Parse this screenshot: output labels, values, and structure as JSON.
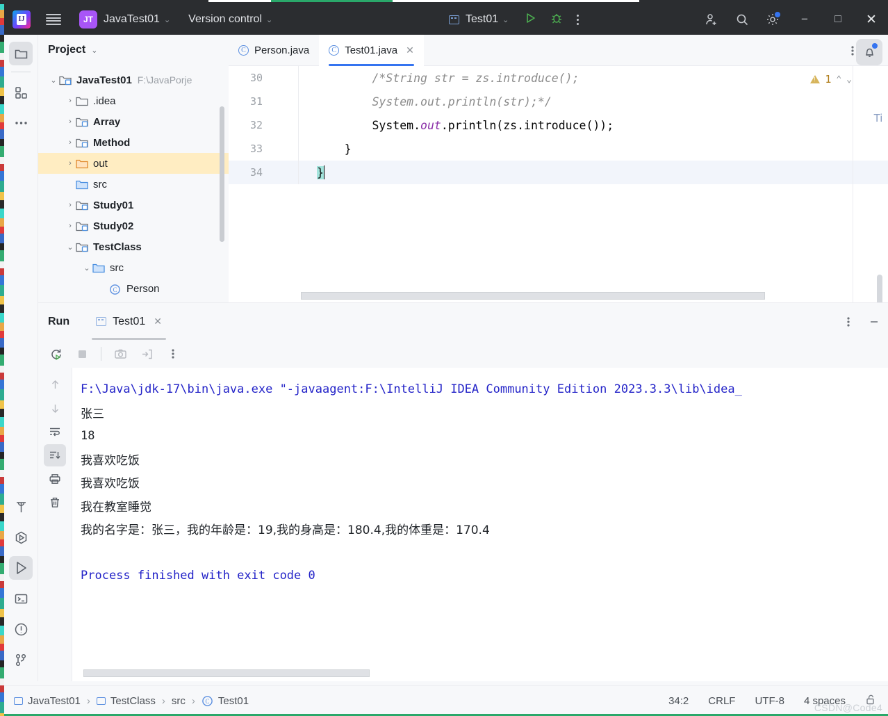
{
  "titlebar": {
    "logo_alt": "intellij-idea-logo",
    "menu_icon": "hamburger-menu-icon",
    "project_badge": "JT",
    "project_name": "JavaTest01",
    "project_chevron": "⌄",
    "vcs_label": "Version control",
    "vcs_chevron": "⌄",
    "run_config_name": "Test01",
    "run_config_chevron": "⌄",
    "run_icon": "run-icon",
    "debug_icon": "debug-icon",
    "more_icon": "more-vertical-icon",
    "add_user_icon": "add-user-icon",
    "search_icon": "search-icon",
    "settings_icon": "settings-gear-icon",
    "minimize": "−",
    "maximize": "□",
    "close": "✕"
  },
  "left_strip": {
    "items": [
      {
        "name": "project-tool-window",
        "icon": "folder-icon",
        "active": true
      },
      {
        "name": "structure-tool-window",
        "icon": "structure-icon",
        "active": false
      },
      {
        "name": "more-tool-windows",
        "icon": "more-horizontal-icon",
        "active": false
      }
    ],
    "bottom_items": [
      {
        "name": "build-tool-window",
        "icon": "hammer-icon",
        "active": false
      },
      {
        "name": "services-tool-window",
        "icon": "run-hex-icon",
        "active": false
      },
      {
        "name": "run-tool-window",
        "icon": "run-triangle-icon",
        "active": true
      },
      {
        "name": "terminal-tool-window",
        "icon": "terminal-icon",
        "active": false
      },
      {
        "name": "problems-tool-window",
        "icon": "exclamation-circle-icon",
        "active": false
      },
      {
        "name": "git-tool-window",
        "icon": "git-branch-icon",
        "active": false
      }
    ]
  },
  "project_panel": {
    "title": "Project",
    "chevron": "⌄",
    "tree": [
      {
        "label": "JavaTest01",
        "path": "F:\\JavaPorje",
        "indent": 0,
        "arrow": "⌄",
        "icon": "module-icon",
        "bold": true,
        "selected": false
      },
      {
        "label": ".idea",
        "path": "",
        "indent": 1,
        "arrow": "›",
        "icon": "folder-icon",
        "bold": false,
        "selected": false
      },
      {
        "label": "Array",
        "path": "",
        "indent": 1,
        "arrow": "›",
        "icon": "module-icon",
        "bold": true,
        "selected": false
      },
      {
        "label": "Method",
        "path": "",
        "indent": 1,
        "arrow": "›",
        "icon": "module-icon",
        "bold": true,
        "selected": false
      },
      {
        "label": "out",
        "path": "",
        "indent": 1,
        "arrow": "›",
        "icon": "folder-orange-icon",
        "bold": false,
        "selected": true
      },
      {
        "label": "src",
        "path": "",
        "indent": 1,
        "arrow": "",
        "icon": "folder-blue-icon",
        "bold": false,
        "selected": false
      },
      {
        "label": "Study01",
        "path": "",
        "indent": 1,
        "arrow": "›",
        "icon": "module-icon",
        "bold": true,
        "selected": false
      },
      {
        "label": "Study02",
        "path": "",
        "indent": 1,
        "arrow": "›",
        "icon": "module-icon",
        "bold": true,
        "selected": false
      },
      {
        "label": "TestClass",
        "path": "",
        "indent": 1,
        "arrow": "⌄",
        "icon": "module-icon",
        "bold": true,
        "selected": false
      },
      {
        "label": "src",
        "path": "",
        "indent": 2,
        "arrow": "⌄",
        "icon": "folder-blue-icon",
        "bold": false,
        "selected": false
      },
      {
        "label": "Person",
        "path": "",
        "indent": 3,
        "arrow": "",
        "icon": "java-class-icon",
        "bold": false,
        "selected": false
      }
    ]
  },
  "editor": {
    "tabs": [
      {
        "label": "Person.java",
        "icon": "java-class-icon",
        "active": false,
        "closable": false
      },
      {
        "label": "Test01.java",
        "icon": "java-class-icon",
        "active": true,
        "closable": true,
        "close": "✕"
      }
    ],
    "tab_options_icon": "more-vertical-icon",
    "tab_minimize_icon": "minimize-icon",
    "inspection": {
      "count": "1",
      "up": "⌃",
      "down": "⌄",
      "icon": "warning-triangle-icon"
    },
    "ghost_text": "Ti",
    "lines": [
      {
        "num": "30",
        "segments": [
          {
            "t": "        ",
            "c": ""
          },
          {
            "t": "/*String str = zs.introduce();",
            "c": "cmt"
          }
        ],
        "current": false
      },
      {
        "num": "31",
        "segments": [
          {
            "t": "        ",
            "c": ""
          },
          {
            "t": "System.out.println(str);*/",
            "c": "cmt"
          }
        ],
        "current": false
      },
      {
        "num": "32",
        "segments": [
          {
            "t": "        System.",
            "c": ""
          },
          {
            "t": "out",
            "c": "kw-static"
          },
          {
            "t": ".println(zs.introduce());",
            "c": ""
          }
        ],
        "current": false
      },
      {
        "num": "33",
        "segments": [
          {
            "t": "    }",
            "c": ""
          }
        ],
        "current": false
      },
      {
        "num": "34",
        "segments": [
          {
            "t": "}",
            "c": "caret-sel"
          }
        ],
        "current": true
      }
    ]
  },
  "run_panel": {
    "title": "Run",
    "tab_label": "Test01",
    "tab_icon": "run-config-icon",
    "tab_close": "✕",
    "options_icon": "more-vertical-icon",
    "minimize_icon": "minimize-icon",
    "toolbar": [
      {
        "name": "rerun-button",
        "icon": "rerun-icon"
      },
      {
        "name": "stop-button",
        "icon": "stop-square-icon"
      },
      {
        "name": "screenshot-button",
        "icon": "camera-icon"
      },
      {
        "name": "dump-threads-button",
        "icon": "export-icon"
      },
      {
        "name": "more-options-button",
        "icon": "more-vertical-icon"
      }
    ],
    "gutter": [
      {
        "name": "scroll-up-button",
        "icon": "arrow-up-icon",
        "active": false
      },
      {
        "name": "scroll-down-button",
        "icon": "arrow-down-icon",
        "active": false
      },
      {
        "name": "soft-wrap-button",
        "icon": "soft-wrap-icon",
        "active": false
      },
      {
        "name": "scroll-to-end-button",
        "icon": "scroll-to-end-icon",
        "active": true
      },
      {
        "name": "print-button",
        "icon": "printer-icon",
        "active": false
      },
      {
        "name": "clear-all-button",
        "icon": "trash-icon",
        "active": false
      }
    ],
    "console_lines": [
      {
        "text": "F:\\Java\\jdk-17\\bin\\java.exe \"-javaagent:F:\\IntelliJ IDEA Community Edition 2023.3.3\\lib\\idea_",
        "style": "blue"
      },
      {
        "text": "张三",
        "style": "cjk"
      },
      {
        "text": "18",
        "style": "mono"
      },
      {
        "text": "我喜欢吃饭",
        "style": "cjk"
      },
      {
        "text": "我喜欢吃饭",
        "style": "cjk"
      },
      {
        "text": "我在教室睡觉",
        "style": "cjk"
      },
      {
        "text": "我的名字是：张三，我的年龄是：19,我的身高是：180.4,我的体重是：170.4",
        "style": "cjk"
      },
      {
        "text": "",
        "style": "mono"
      },
      {
        "text": "Process finished with exit code 0",
        "style": "blue"
      }
    ]
  },
  "status_bar": {
    "breadcrumbs": [
      {
        "label": "JavaTest01",
        "icon": "module-icon"
      },
      {
        "label": "TestClass",
        "icon": "module-icon"
      },
      {
        "label": "src",
        "icon": ""
      },
      {
        "label": "Test01",
        "icon": "java-class-icon"
      }
    ],
    "separator": "›",
    "caret_position": "34:2",
    "line_separator": "CRLF",
    "encoding": "UTF-8",
    "indent": "4 spaces",
    "lock_icon": "unlocked-icon",
    "watermark": "CSDN@Code4"
  },
  "notification": {
    "icon": "bell-icon",
    "has_badge": true
  }
}
